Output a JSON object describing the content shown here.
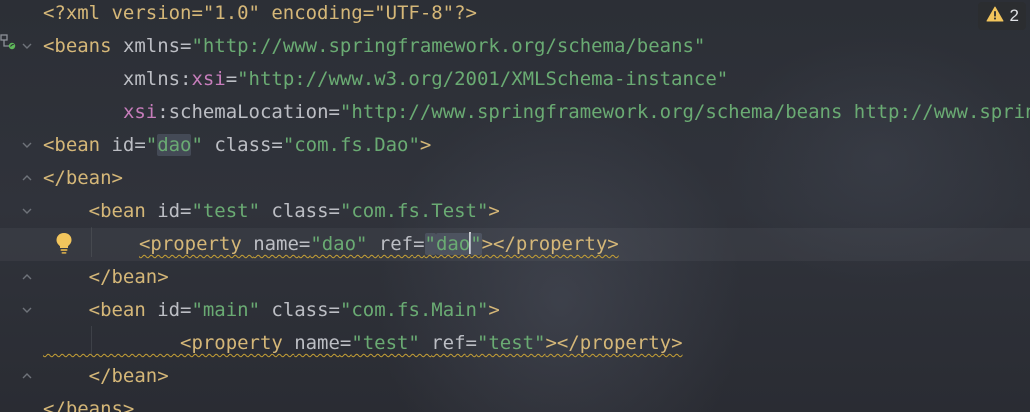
{
  "editor": {
    "lines": [
      {
        "tokens": [
          {
            "t": "<?xml version=\"1.0\" encoding=\"UTF-8\"?>",
            "c": "tag"
          }
        ]
      },
      {
        "tokens": [
          {
            "t": "<beans ",
            "c": "tag"
          },
          {
            "t": "xmlns",
            "c": "attr"
          },
          {
            "t": "=",
            "c": "punct"
          },
          {
            "t": "\"http://www.springframework.org/schema/beans\"",
            "c": "val"
          }
        ]
      },
      {
        "tokens": [
          {
            "t": "       xmlns:",
            "c": "attr"
          },
          {
            "t": "xsi",
            "c": "ns"
          },
          {
            "t": "=",
            "c": "punct"
          },
          {
            "t": "\"http://www.w3.org/2001/XMLSchema-instance\"",
            "c": "val"
          }
        ]
      },
      {
        "tokens": [
          {
            "t": "       ",
            "c": "attr"
          },
          {
            "t": "xsi",
            "c": "ns"
          },
          {
            "t": ":schemaLocation",
            "c": "attr"
          },
          {
            "t": "=",
            "c": "punct"
          },
          {
            "t": "\"http://www.springframework.org/schema/beans http://www.springframework.org/schema/beans/spring-beans.xsd\"",
            "c": "val"
          }
        ]
      },
      {
        "tokens": [
          {
            "t": "<bean ",
            "c": "tag"
          },
          {
            "t": "id",
            "c": "attr"
          },
          {
            "t": "=",
            "c": "punct"
          },
          {
            "t": "\"",
            "c": "val"
          },
          {
            "t": "dao",
            "c": "val hl"
          },
          {
            "t": "\" ",
            "c": "val"
          },
          {
            "t": "class",
            "c": "attr"
          },
          {
            "t": "=",
            "c": "punct"
          },
          {
            "t": "\"com.fs.Dao\"",
            "c": "val"
          },
          {
            "t": ">",
            "c": "tag"
          }
        ]
      },
      {
        "tokens": [
          {
            "t": "</bean>",
            "c": "tag"
          }
        ]
      },
      {
        "tokens": [
          {
            "t": "    <bean ",
            "c": "tag"
          },
          {
            "t": "id",
            "c": "attr"
          },
          {
            "t": "=",
            "c": "punct"
          },
          {
            "t": "\"test\" ",
            "c": "val"
          },
          {
            "t": "class",
            "c": "attr"
          },
          {
            "t": "=",
            "c": "punct"
          },
          {
            "t": "\"com.fs.Test\"",
            "c": "val"
          },
          {
            "t": ">",
            "c": "tag"
          }
        ]
      },
      {
        "tokens": [
          {
            "t": "<property ",
            "c": "tag warn-u"
          },
          {
            "t": "name",
            "c": "attr warn-u"
          },
          {
            "t": "=",
            "c": "punct warn-u"
          },
          {
            "t": "\"dao\" ",
            "c": "val warn-u"
          },
          {
            "t": "ref",
            "c": "attr warn-u"
          },
          {
            "t": "=",
            "c": "punct warn-u"
          },
          {
            "t": "\"",
            "c": "val hl warn-u"
          },
          {
            "t": "dao",
            "c": "val hl warn-u"
          },
          {
            "t": "CARET",
            "c": "caret"
          },
          {
            "t": "\"",
            "c": "val hl warn-u"
          },
          {
            "t": "></property>",
            "c": "tag warn-u"
          }
        ]
      },
      {
        "tokens": [
          {
            "t": "    </bean>",
            "c": "tag"
          }
        ]
      },
      {
        "tokens": [
          {
            "t": "    <bean ",
            "c": "tag"
          },
          {
            "t": "id",
            "c": "attr"
          },
          {
            "t": "=",
            "c": "punct"
          },
          {
            "t": "\"main\" ",
            "c": "val"
          },
          {
            "t": "class",
            "c": "attr"
          },
          {
            "t": "=",
            "c": "punct"
          },
          {
            "t": "\"com.fs.Main\"",
            "c": "val"
          },
          {
            "t": ">",
            "c": "tag"
          }
        ]
      },
      {
        "tokens": [
          {
            "t": "            <property ",
            "c": "tag warn-u"
          },
          {
            "t": "name",
            "c": "attr warn-u"
          },
          {
            "t": "=",
            "c": "punct warn-u"
          },
          {
            "t": "\"test\" ",
            "c": "val warn-u"
          },
          {
            "t": "ref",
            "c": "attr warn-u"
          },
          {
            "t": "=",
            "c": "punct warn-u"
          },
          {
            "t": "\"test\"",
            "c": "val warn-u"
          },
          {
            "t": "></property>",
            "c": "tag warn-u"
          }
        ]
      },
      {
        "tokens": [
          {
            "t": "    </bean>",
            "c": "tag"
          }
        ]
      },
      {
        "tokens": [
          {
            "t": "</beans>",
            "c": "tag"
          }
        ]
      }
    ]
  },
  "inspections": {
    "warning_count": "2",
    "icon": "warning-triangle-icon"
  },
  "gutter": {
    "fold_icons": [
      "chevron-down-icon"
    ],
    "intention_icon": "lightbulb-icon",
    "structure_icon": "spring-bean-icon"
  },
  "colors": {
    "tag": "#d5b778",
    "attr": "#bcbec4",
    "namespace": "#c77dbb",
    "value": "#6aab73",
    "warning": "#c7a135"
  }
}
